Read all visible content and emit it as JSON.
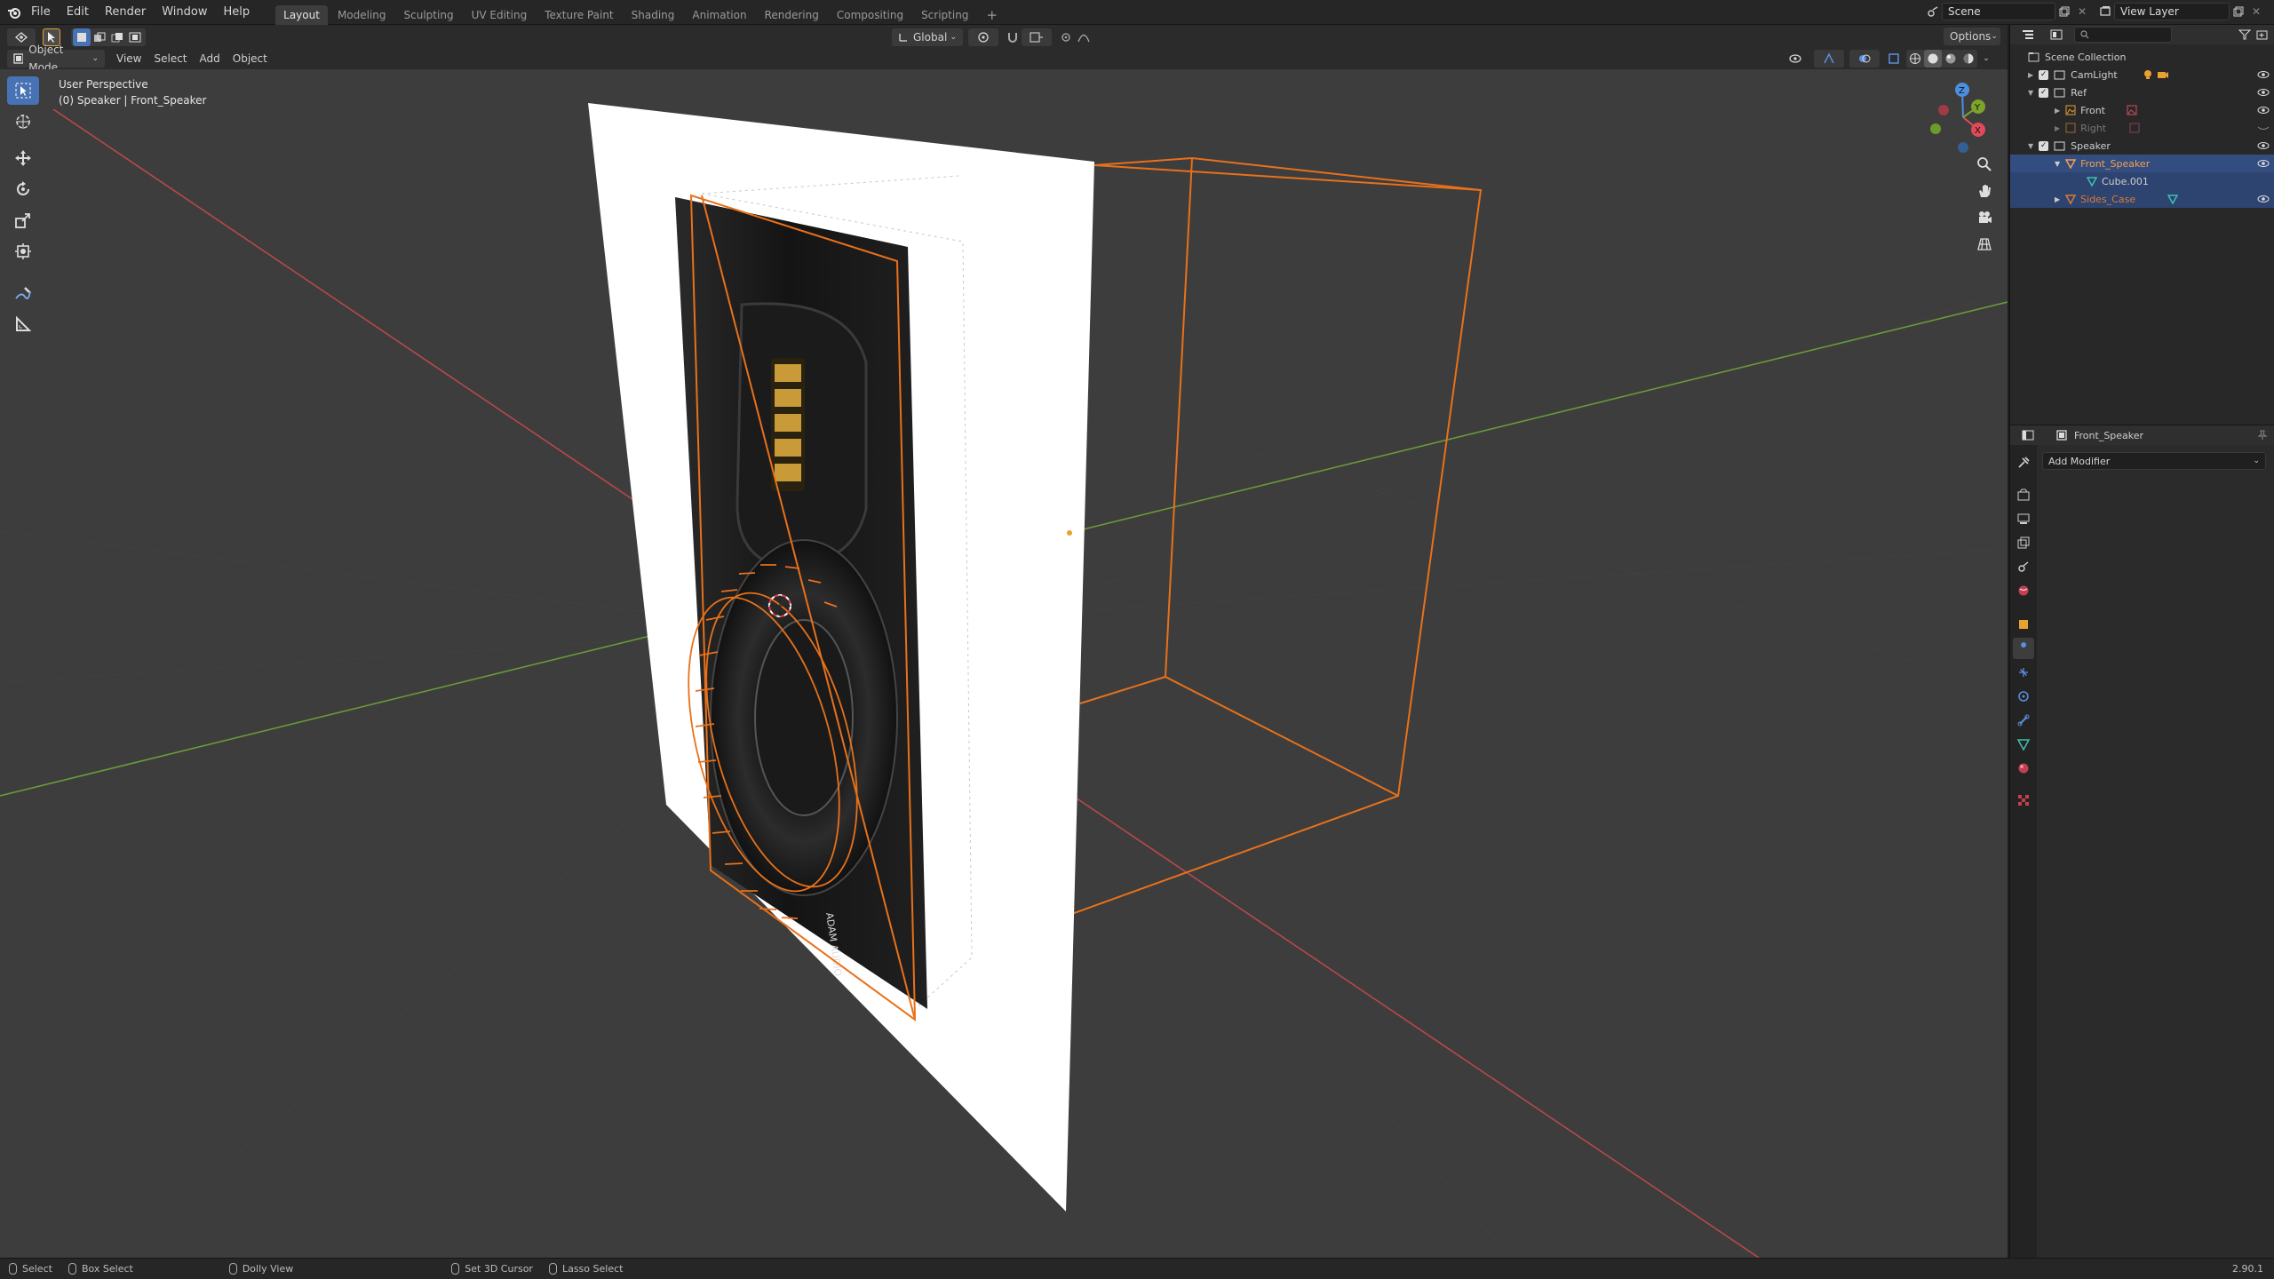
{
  "menubar": {
    "items": [
      "File",
      "Edit",
      "Render",
      "Window",
      "Help"
    ],
    "workspaces": [
      "Layout",
      "Modeling",
      "Sculpting",
      "UV Editing",
      "Texture Paint",
      "Shading",
      "Animation",
      "Rendering",
      "Compositing",
      "Scripting"
    ],
    "active_workspace": "Layout",
    "scene": "Scene",
    "view_layer": "View Layer"
  },
  "viewport_header": {
    "mode": "Object Mode",
    "menus": [
      "View",
      "Select",
      "Add",
      "Object"
    ],
    "transform_orientation": "Global",
    "options_label": "Options"
  },
  "viewport": {
    "perspective_label": "User Perspective",
    "context_label": "(0) Speaker | Front_Speaker",
    "axis_x_color": "#b8484a",
    "axis_y_color": "#6a9a3a",
    "selection_color": "#e8711a",
    "gizmo": {
      "x": "X",
      "y": "Y",
      "z": "Z"
    }
  },
  "outliner": {
    "root": "Scene Collection",
    "rows": [
      {
        "label": "CamLight",
        "indent": 1
      },
      {
        "label": "Ref",
        "indent": 1
      },
      {
        "label": "Front",
        "indent": 2
      },
      {
        "label": "Right",
        "indent": 2
      },
      {
        "label": "Speaker",
        "indent": 1
      },
      {
        "label": "Front_Speaker",
        "indent": 2
      },
      {
        "label": "Cube.001",
        "indent": 3
      },
      {
        "label": "Sides_Case",
        "indent": 2
      }
    ]
  },
  "properties": {
    "object_name": "Front_Speaker",
    "add_modifier_label": "Add Modifier"
  },
  "statusbar": {
    "items": [
      "Select",
      "Box Select",
      "Dolly View",
      "Set 3D Cursor",
      "Lasso Select"
    ],
    "version": "2.90.1"
  }
}
